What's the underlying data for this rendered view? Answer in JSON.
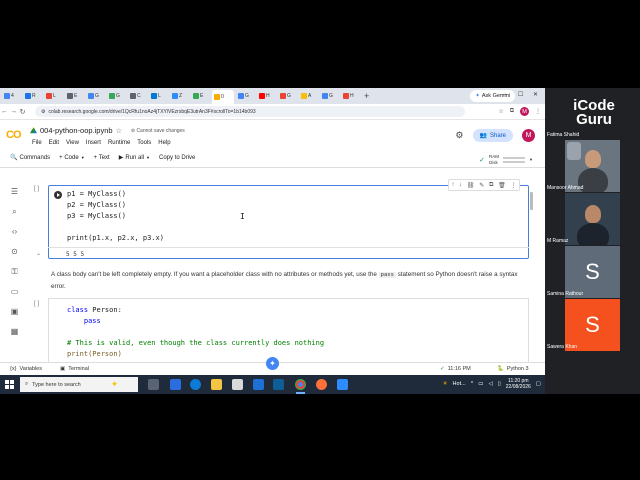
{
  "browser": {
    "tabs": [
      {
        "label": "4",
        "color": "#4285f4"
      },
      {
        "label": "R",
        "color": "#1a73e8"
      },
      {
        "label": "L",
        "color": "#e94235"
      },
      {
        "label": "E",
        "color": "#5f6368"
      },
      {
        "label": "G",
        "color": "#4285f4"
      },
      {
        "label": "G",
        "color": "#34a853"
      },
      {
        "label": "C",
        "color": "#5f6368"
      },
      {
        "label": "L",
        "color": "#0078d4"
      },
      {
        "label": "Z",
        "color": "#2d8cff"
      },
      {
        "label": "E",
        "color": "#34a853"
      },
      {
        "label": "0",
        "color": "#f9ab00",
        "active": true
      },
      {
        "label": "G",
        "color": "#4285f4"
      },
      {
        "label": "H",
        "color": "#ff0000"
      },
      {
        "label": "G",
        "color": "#ea4335"
      },
      {
        "label": "A",
        "color": "#fbbc04"
      },
      {
        "label": "G",
        "color": "#4285f4"
      },
      {
        "label": "H",
        "color": "#ea4335"
      }
    ],
    "new_tab": "+",
    "ask_gemini": "Ask Gemini",
    "url": "colab.research.google.com/drive/1QcRfu1noAz4jTXYlVEzrsbqE3utrAn3F#scrollTo=1b14b093",
    "profile_initial": "M"
  },
  "colab": {
    "title": "004-python-oop.ipynb",
    "save_status": "Cannot save changes",
    "menu": [
      "File",
      "Edit",
      "View",
      "Insert",
      "Runtime",
      "Tools",
      "Help"
    ],
    "share_label": "Share",
    "toolbar": {
      "commands": "Commands",
      "code": "+ Code",
      "text": "+ Text",
      "run_all": "Run all",
      "copy_to_drive": "Copy to Drive"
    },
    "ram_label": "RAM",
    "disk_label": "Disk",
    "cell1": {
      "bracket": "[ ]",
      "lines": [
        "p1 = MyClass()",
        "p2 = MyClass()",
        "p3 = MyClass()",
        "",
        "print(p1.x, p2.x, p3.x)"
      ],
      "output": "5 5 5"
    },
    "text_cell": {
      "part1": "A class body can't be left completely empty. If you want a placeholder class with no attributes or methods yet, use the",
      "code": "pass",
      "part2": "statement so Python doesn't raise a syntax error."
    },
    "cell2": {
      "bracket": "[ ]",
      "line1_kw": "class",
      "line1_rest": " Person:",
      "line2": "    pass",
      "line3": "# This is valid, even though the class currently does nothing",
      "line4": "print(Person)"
    },
    "status": {
      "variables": "Variables",
      "terminal": "Terminal",
      "time": "11:16 PM",
      "kernel": "Python 3"
    }
  },
  "taskbar": {
    "search_placeholder": "Type here to search",
    "weather": "Hot...",
    "time": "11:20 pm",
    "date": "22/08/2026"
  },
  "meeting": {
    "brand_line1": "iCode",
    "brand_line2": "Guru",
    "participants": [
      {
        "name": "Fatima Shahid"
      },
      {
        "name": "Mansoor Ahmad"
      },
      {
        "name": "M Ramaz"
      },
      {
        "name": "Samina Rathour",
        "initial": "S",
        "color": "#5f6b78"
      },
      {
        "name": "Sawera Khan",
        "initial": "S",
        "color": "#f4511e"
      }
    ]
  },
  "colors": {
    "cell_focus_border": "#4a7ede",
    "colab_orange": "#f9ab00",
    "share_bg": "#d3e3fd"
  }
}
